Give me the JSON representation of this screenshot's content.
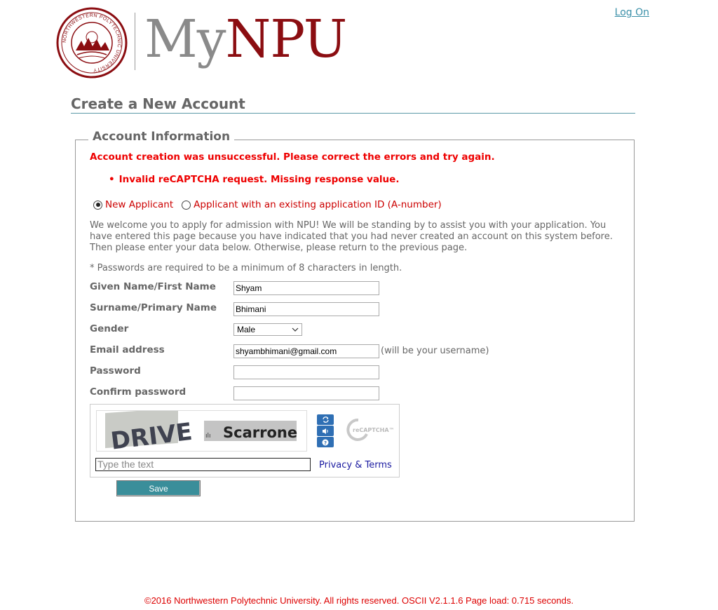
{
  "header": {
    "brand_my": "My",
    "brand_npu": "NPU",
    "seal_text": "NORTHWESTERN POLYTECHNIC UNIVERSITY",
    "logon_label": "Log On"
  },
  "page_title": "Create a New Account",
  "form": {
    "legend": "Account Information",
    "error_summary": "Account creation was unsuccessful. Please correct the errors and try again.",
    "errors": [
      "Invalid reCAPTCHA request. Missing response value."
    ],
    "applicant_type": {
      "options": [
        "New Applicant",
        "Applicant with an existing application ID (A-number)"
      ],
      "selected_index": 0
    },
    "welcome_text": "We welcome you to apply for admission with NPU! We will be standing by to assist you with your application. You have entered this page because you have indicated that you had never created an account on this system before. Then please enter your data below. Otherwise, please return to the previous page.",
    "password_note": "* Passwords are required to be a minimum of 8 characters in length.",
    "fields": {
      "first_name": {
        "label": "Given Name/First Name",
        "value": "Shyam"
      },
      "surname": {
        "label": "Surname/Primary Name",
        "value": "Bhimani"
      },
      "gender": {
        "label": "Gender",
        "value": "Male"
      },
      "email": {
        "label": "Email address",
        "value": "shyambhimani@gmail.com",
        "note": "(will be your username)"
      },
      "password": {
        "label": "Password",
        "value": ""
      },
      "confirm_password": {
        "label": "Confirm password",
        "value": ""
      }
    },
    "recaptcha": {
      "word1": "DRIVE",
      "word2_prefix": "ılı",
      "word2": "Scarrone",
      "input_placeholder": "Type the text",
      "privacy_label": "Privacy & Terms",
      "logo_text": "reCAPTCHA™",
      "refresh_icon": "refresh-icon",
      "audio_icon": "audio-icon",
      "help_icon": "help-icon"
    },
    "save_label": "Save"
  },
  "footer": "©2016 Northwestern Polytechnic University. All rights reserved. OSCII V2.1.1.6 Page load: 0.715 seconds.",
  "colors": {
    "brand_red": "#8b0d11",
    "error_red": "#ee0000",
    "teal": "#3a8e9a",
    "link_blue": "#1a1aa0"
  }
}
